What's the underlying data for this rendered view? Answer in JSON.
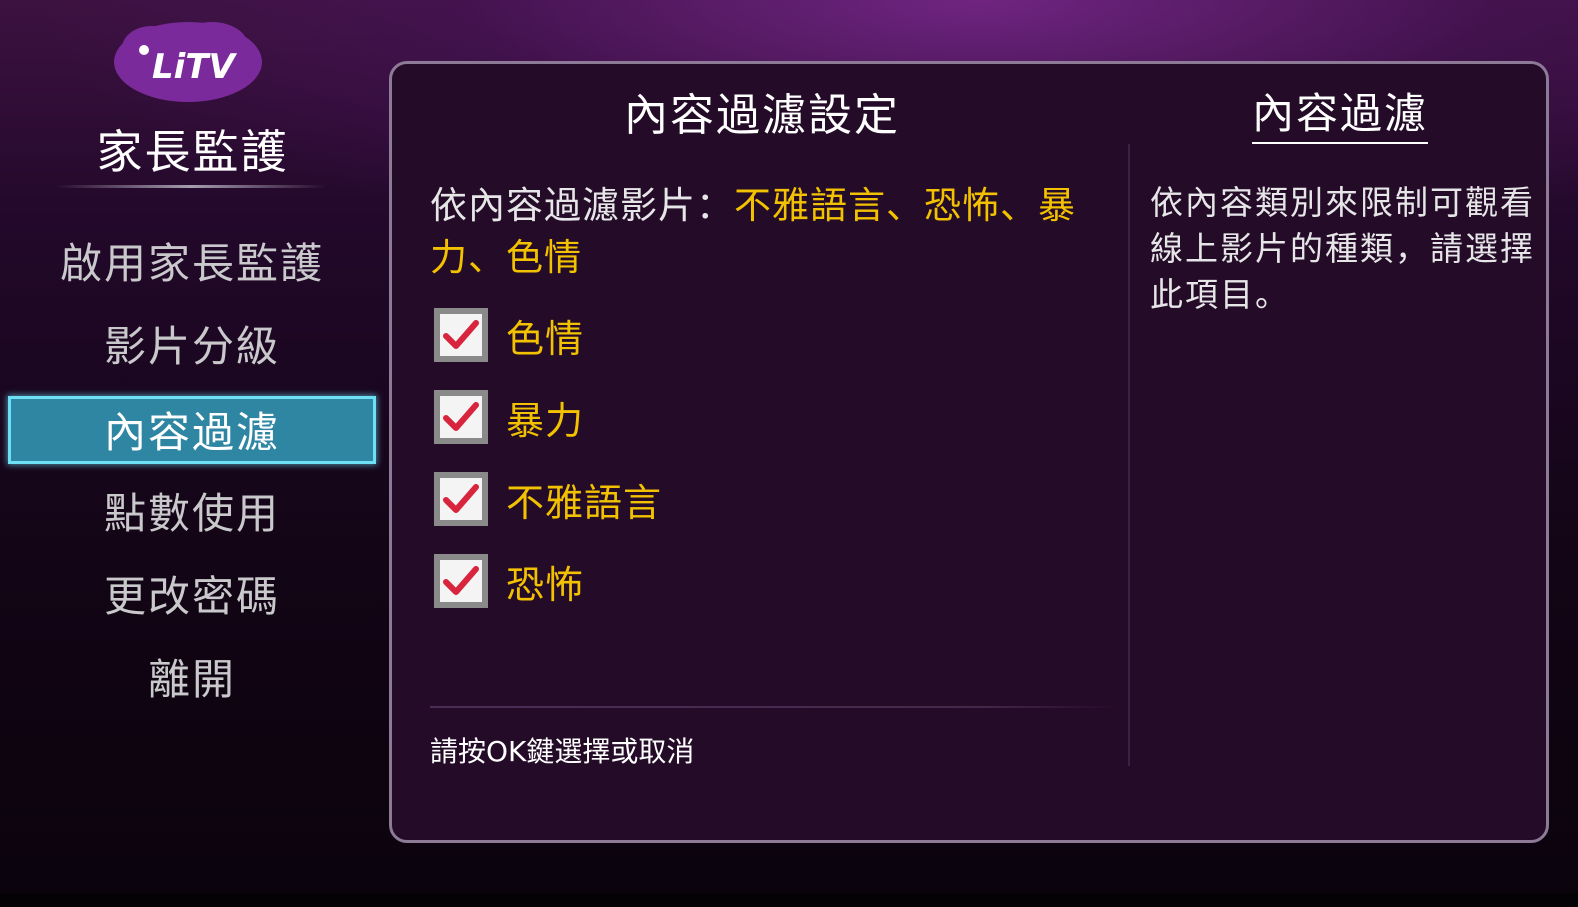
{
  "brand": {
    "logo_text": "LiTV",
    "logo_color": "#7a2a9a"
  },
  "sidebar": {
    "title": "家長監護",
    "items": [
      {
        "label": "啟用家長監護",
        "active": false
      },
      {
        "label": "影片分級",
        "active": false
      },
      {
        "label": "內容過濾",
        "active": true
      },
      {
        "label": "點數使用",
        "active": false
      },
      {
        "label": "更改密碼",
        "active": false
      },
      {
        "label": "離開",
        "active": false
      }
    ]
  },
  "main": {
    "title": "內容過濾設定",
    "description_prefix": "依內容過濾影片：",
    "description_value": "不雅語言、恐怖、暴力、色情",
    "options": [
      {
        "label": "色情",
        "checked": true
      },
      {
        "label": "暴力",
        "checked": true
      },
      {
        "label": "不雅語言",
        "checked": true
      },
      {
        "label": "恐怖",
        "checked": true
      }
    ],
    "hint": "請按OK鍵選擇或取消"
  },
  "help": {
    "title": "內容過濾",
    "text": "依內容類別來限制可觀看線上影片的種類，請選擇此項目。"
  },
  "colors": {
    "highlight": "#f2c200",
    "active_item_bg": "#2f86a3",
    "active_item_border": "#6ee0f5",
    "check_mark": "#d8243c"
  }
}
